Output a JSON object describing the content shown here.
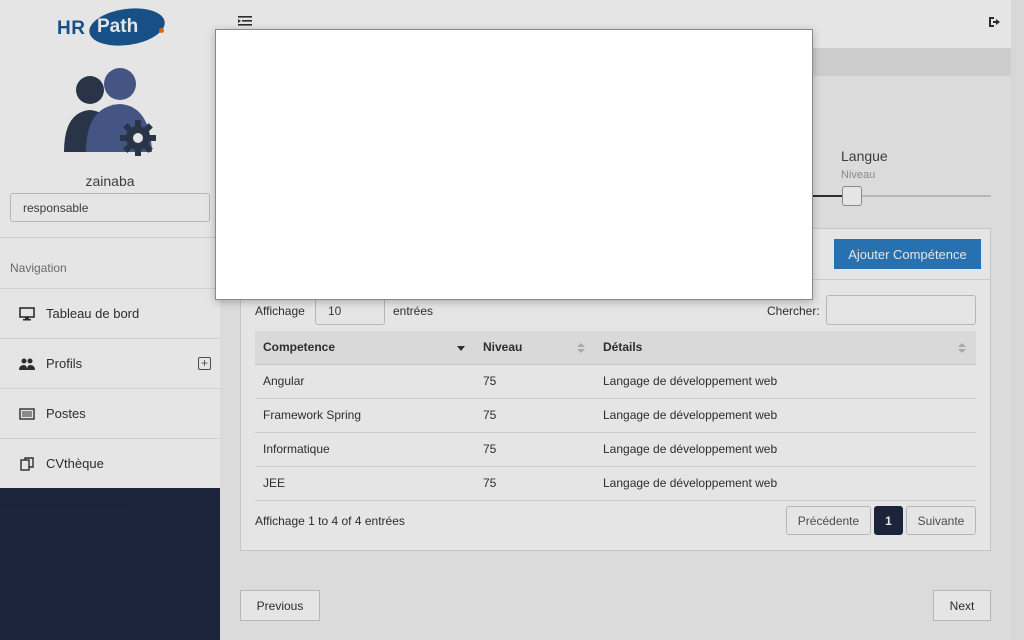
{
  "brand": {
    "part1": "HR",
    "part2": "Path"
  },
  "user": {
    "name": "zainaba",
    "role": "responsable"
  },
  "nav": {
    "title": "Navigation",
    "items": [
      {
        "label": "Tableau de bord",
        "icon": "monitor-icon"
      },
      {
        "label": "Profils",
        "icon": "users-icon"
      },
      {
        "label": "Postes",
        "icon": "list-icon"
      },
      {
        "label": "CVthèque",
        "icon": "copy-icon"
      }
    ],
    "expand_symbol": "+"
  },
  "language": {
    "title": "Langue",
    "level_label": "Niveau",
    "level_value_fraction": 0.17
  },
  "panel": {
    "add_button": "Ajouter Compétence",
    "show_label": "Affichage",
    "page_size": "10",
    "entries_label": "entrées",
    "search_label": "Chercher:",
    "search_value": "",
    "columns": [
      "Competence",
      "Niveau",
      "Détails"
    ],
    "rows": [
      [
        "Angular",
        "75",
        "Langage de développement web"
      ],
      [
        "Framework Spring",
        "75",
        "Langage de développement web"
      ],
      [
        "Informatique",
        "75",
        "Langage de développement web"
      ],
      [
        "JEE",
        "75",
        "Langage de développement web"
      ]
    ],
    "info": "Affichage 1 to 4 of 4 entrées",
    "pagination": {
      "prev": "Précédente",
      "current": "1",
      "next": "Suivante"
    }
  },
  "wizard": {
    "previous": "Previous",
    "next": "Next"
  },
  "colors": {
    "accent": "#2c7ec4",
    "dark": "#1f2942",
    "brand": "#1a5a96",
    "brand_dot": "#e8731a"
  }
}
